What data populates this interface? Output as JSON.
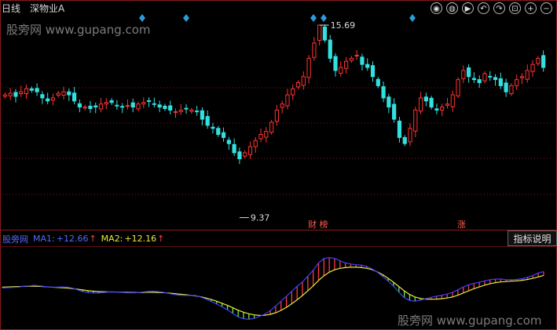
{
  "header": {
    "period": "日线",
    "stock_name": "深物业A"
  },
  "toolbar": {
    "icons": [
      "eye-icon",
      "record-icon",
      "play-icon",
      "undo-icon",
      "redo-icon",
      "lock-icon",
      "zoom-in-icon",
      "zoom-out-icon"
    ],
    "glyphs": [
      "◉",
      "◍",
      "▶",
      "↶",
      "↷",
      "⊡",
      "+",
      "−"
    ]
  },
  "watermark": "股旁网 www.gupang.com",
  "price_labels": {
    "high": "15.69",
    "low": "9.37"
  },
  "annotations": {
    "tag1": "财 榜",
    "tag2": "涨"
  },
  "indicator": {
    "name": "股旁网",
    "ma1_label": "MA1:",
    "ma1_value": "+12.66",
    "ma1_arrow": "↑",
    "ma2_label": "MA2:",
    "ma2_value": "+12.16",
    "ma2_arrow": "↑",
    "button": "指标说明"
  },
  "colors": {
    "up": "#ff3333",
    "down": "#33e0e0",
    "ma1": "#4040ff",
    "ma2": "#e8e840",
    "hist_up": "#ff3b3b",
    "hist_down": "#66ee33",
    "grid": "#8b1a1a",
    "diamond": "#2a9bdc"
  },
  "chart_data": {
    "type": "candlestick",
    "closes": [
      13.4,
      13.45,
      13.35,
      13.5,
      13.6,
      13.55,
      13.5,
      13.3,
      13.2,
      13.3,
      13.45,
      13.5,
      13.4,
      13.2,
      13.0,
      13.0,
      12.95,
      13.0,
      13.1,
      13.15,
      13.15,
      13.05,
      13.0,
      13.05,
      13.0,
      13.1,
      13.15,
      13.2,
      13.1,
      13.0,
      12.95,
      12.9,
      12.85,
      12.9,
      12.95,
      12.9,
      12.85,
      12.6,
      12.4,
      12.3,
      12.1,
      12.0,
      11.8,
      11.5,
      11.3,
      11.5,
      11.7,
      11.9,
      12.1,
      12.2,
      12.5,
      12.9,
      13.1,
      13.4,
      13.6,
      13.8,
      14.0,
      14.6,
      15.1,
      15.69,
      15.2,
      14.6,
      14.2,
      14.3,
      14.5,
      14.6,
      14.7,
      14.4,
      14.3,
      14.0,
      13.7,
      13.3,
      13.0,
      12.6,
      12.0,
      11.8,
      12.3,
      12.9,
      13.3,
      13.2,
      13.0,
      12.9,
      13.0,
      13.1,
      13.4,
      13.9,
      14.2,
      14.0,
      13.9,
      13.8,
      14.1,
      14.0,
      13.9,
      13.7,
      13.5,
      13.7,
      13.9,
      14.0,
      14.2,
      14.4,
      14.6,
      14.3
    ],
    "high": 15.69,
    "low": 9.37,
    "ma1": [
      13.3,
      13.32,
      13.33,
      13.35,
      13.4,
      13.42,
      13.45,
      13.42,
      13.38,
      13.35,
      13.35,
      13.36,
      13.35,
      13.3,
      13.2,
      13.1,
      13.05,
      13.02,
      13.02,
      13.05,
      13.08,
      13.08,
      13.06,
      13.04,
      13.03,
      13.04,
      13.07,
      13.1,
      13.12,
      13.1,
      13.06,
      13.0,
      12.94,
      12.9,
      12.89,
      12.89,
      12.88,
      12.8,
      12.68,
      12.55,
      12.4,
      12.25,
      12.08,
      11.88,
      11.68,
      11.58,
      11.55,
      11.6,
      11.72,
      11.85,
      12.04,
      12.3,
      12.56,
      12.84,
      13.12,
      13.4,
      13.64,
      13.96,
      14.3,
      14.7,
      14.95,
      15.0,
      14.95,
      14.82,
      14.7,
      14.64,
      14.6,
      14.58,
      14.5,
      14.36,
      14.18,
      13.94,
      13.68,
      13.4,
      13.06,
      12.76,
      12.6,
      12.56,
      12.62,
      12.7,
      12.78,
      12.84,
      12.9,
      12.96,
      13.06,
      13.2,
      13.36,
      13.48,
      13.56,
      13.62,
      13.7,
      13.76,
      13.8,
      13.8,
      13.76,
      13.76,
      13.78,
      13.82,
      13.9,
      14.0,
      14.14,
      14.22
    ],
    "ma2": [
      13.35,
      13.36,
      13.37,
      13.38,
      13.39,
      13.4,
      13.4,
      13.39,
      13.37,
      13.35,
      13.33,
      13.32,
      13.3,
      13.27,
      13.23,
      13.19,
      13.15,
      13.12,
      13.1,
      13.09,
      13.08,
      13.08,
      13.07,
      13.06,
      13.05,
      13.05,
      13.05,
      13.06,
      13.06,
      13.05,
      13.04,
      13.02,
      12.99,
      12.96,
      12.93,
      12.9,
      12.86,
      12.81,
      12.74,
      12.66,
      12.56,
      12.45,
      12.33,
      12.2,
      12.06,
      11.95,
      11.86,
      11.8,
      11.77,
      11.78,
      11.83,
      11.92,
      12.05,
      12.22,
      12.42,
      12.64,
      12.88,
      13.14,
      13.42,
      13.72,
      13.98,
      14.18,
      14.32,
      14.4,
      14.44,
      14.46,
      14.46,
      14.44,
      14.4,
      14.32,
      14.2,
      14.04,
      13.84,
      13.62,
      13.38,
      13.14,
      12.94,
      12.8,
      12.72,
      12.68,
      12.67,
      12.68,
      12.7,
      12.74,
      12.8,
      12.9,
      13.02,
      13.14,
      13.26,
      13.36,
      13.46,
      13.54,
      13.6,
      13.64,
      13.66,
      13.68,
      13.7,
      13.73,
      13.78,
      13.84,
      13.92,
      14.0
    ]
  }
}
